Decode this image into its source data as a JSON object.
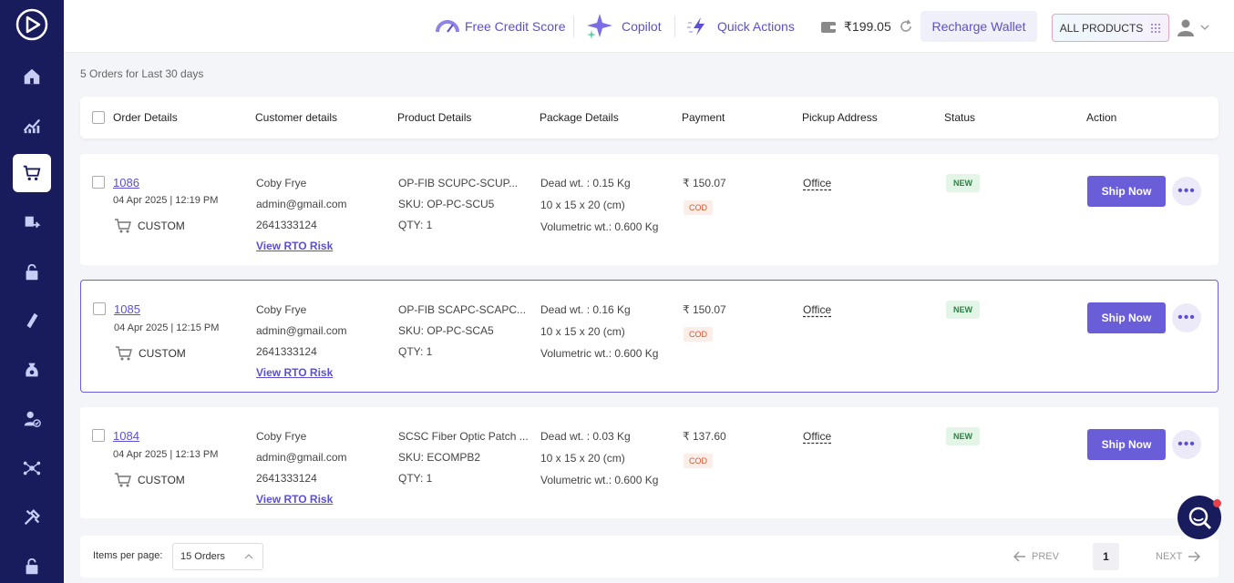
{
  "header": {
    "free_credit_score": "Free Credit Score",
    "copilot": "Copilot",
    "quick_actions": "Quick Actions",
    "wallet_balance": "₹199.05",
    "recharge_wallet": "Recharge Wallet",
    "all_products": "ALL PRODUCTS"
  },
  "subtitle": "5 Orders for Last 30 days",
  "columns": {
    "order": "Order Details",
    "customer": "Customer details",
    "product": "Product Details",
    "package": "Package Details",
    "payment": "Payment",
    "pickup": "Pickup Address",
    "status": "Status",
    "action": "Action"
  },
  "orders": [
    {
      "id": "1086",
      "date": "04 Apr 2025 | 12:19 PM",
      "channel": "CUSTOM",
      "customer_name": "Coby Frye",
      "email": "admin@gmail.com",
      "phone": "2641333124",
      "rto_link": "View RTO Risk",
      "product_name": "OP-FIB SCUPC-SCUP...",
      "sku": "SKU:  OP-PC-SCU5",
      "qty": "QTY: 1",
      "dead_wt": "Dead wt. : 0.15 Kg",
      "dims": "10 x 15 x 20 (cm)",
      "vol_wt": "Volumetric wt.:  0.600 Kg",
      "amount": "₹ 150.07",
      "payment_mode": "COD",
      "pickup": "Office",
      "status": "NEW",
      "ship_label": "Ship Now",
      "more": "•••"
    },
    {
      "id": "1085",
      "date": "04 Apr 2025 | 12:15 PM",
      "channel": "CUSTOM",
      "customer_name": "Coby Frye",
      "email": "admin@gmail.com",
      "phone": "2641333124",
      "rto_link": "View RTO Risk",
      "product_name": "OP-FIB SCAPC-SCAPC...",
      "sku": "SKU:  OP-PC-SCA5",
      "qty": "QTY: 1",
      "dead_wt": "Dead wt. : 0.16 Kg",
      "dims": "10 x 15 x 20 (cm)",
      "vol_wt": "Volumetric wt.:  0.600 Kg",
      "amount": "₹ 150.07",
      "payment_mode": "COD",
      "pickup": "Office",
      "status": "NEW",
      "ship_label": "Ship Now",
      "more": "•••"
    },
    {
      "id": "1084",
      "date": "04 Apr 2025 | 12:13 PM",
      "channel": "CUSTOM",
      "customer_name": "Coby Frye",
      "email": "admin@gmail.com",
      "phone": "2641333124",
      "rto_link": "View RTO Risk",
      "product_name": "SCSC Fiber Optic Patch ...",
      "sku": "SKU:  ECOMPB2",
      "qty": "QTY: 1",
      "dead_wt": "Dead wt. : 0.03 Kg",
      "dims": "10 x 15 x 20 (cm)",
      "vol_wt": "Volumetric wt.:  0.600 Kg",
      "amount": "₹ 137.60",
      "payment_mode": "COD",
      "pickup": "Office",
      "status": "NEW",
      "ship_label": "Ship Now",
      "more": "•••"
    }
  ],
  "footer": {
    "items_per_page_label": "Items per page:",
    "items_per_page_value": "15 Orders",
    "prev": "PREV",
    "page": "1",
    "next": "NEXT"
  },
  "colors": {
    "sidebar": "#181b5c",
    "accent": "#6a5ed8",
    "cod": "#d1582f",
    "new": "#1f8a3b"
  }
}
